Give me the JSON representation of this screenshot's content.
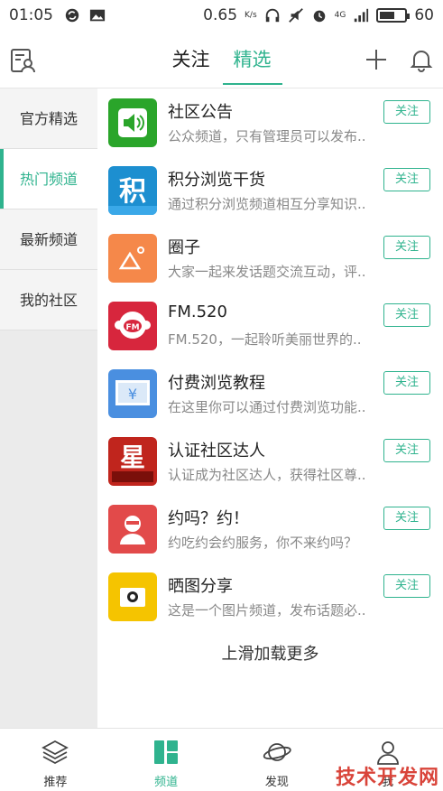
{
  "status_bar": {
    "time": "01:05",
    "network_speed": "0.65",
    "network_unit": "K/s",
    "network_type": "4G",
    "battery": "60",
    "battery_level": 0.6
  },
  "header": {
    "tabs": [
      {
        "label": "关注",
        "active": false
      },
      {
        "label": "精选",
        "active": true
      }
    ]
  },
  "sidebar": {
    "items": [
      {
        "label": "官方精选",
        "active": false
      },
      {
        "label": "热门频道",
        "active": true
      },
      {
        "label": "最新频道",
        "active": false
      },
      {
        "label": "我的社区",
        "active": false
      }
    ]
  },
  "channels": [
    {
      "title": "社区公告",
      "desc": "公众频道，只有管理员可以发布..",
      "follow": "关注",
      "icon": "megaphone-icon",
      "color": "#2aa52a"
    },
    {
      "title": "积分浏览干货",
      "desc": "通过积分浏览频道相互分享知识..",
      "follow": "关注",
      "icon": "points-icon",
      "color": "#1d8fd0"
    },
    {
      "title": "圈子",
      "desc": "大家一起来发话题交流互动，评..",
      "follow": "关注",
      "icon": "mountain-icon",
      "color": "#f5884a"
    },
    {
      "title": "FM.520",
      "desc": "FM.520，一起聆听美丽世界的..",
      "follow": "关注",
      "icon": "radio-icon",
      "color": "#d7263d"
    },
    {
      "title": "付费浏览教程",
      "desc": "在这里你可以通过付费浏览功能..",
      "follow": "关注",
      "icon": "yuan-screen-icon",
      "color": "#4a8fe0"
    },
    {
      "title": "认证社区达人",
      "desc": "认证成为社区达人，获得社区尊..",
      "follow": "关注",
      "icon": "star-badge-icon",
      "color": "#c0251d"
    },
    {
      "title": "约吗？约！",
      "desc": "约吃约会约服务，你不来约吗？",
      "follow": "关注",
      "icon": "person-icon",
      "color": "#e24a4a"
    },
    {
      "title": "晒图分享",
      "desc": "这是一个图片频道，发布话题必..",
      "follow": "关注",
      "icon": "camera-icon",
      "color": "#f5c400"
    }
  ],
  "load_more": "上滑加载更多",
  "bottom_nav": [
    {
      "label": "推荐",
      "icon": "layers-icon",
      "active": false
    },
    {
      "label": "频道",
      "icon": "channels-icon",
      "active": true
    },
    {
      "label": "发现",
      "icon": "planet-icon",
      "active": false
    },
    {
      "label": "我",
      "icon": "user-icon",
      "active": false
    }
  ],
  "watermark": "技术开发网",
  "colors": {
    "accent": "#2fb38e"
  }
}
